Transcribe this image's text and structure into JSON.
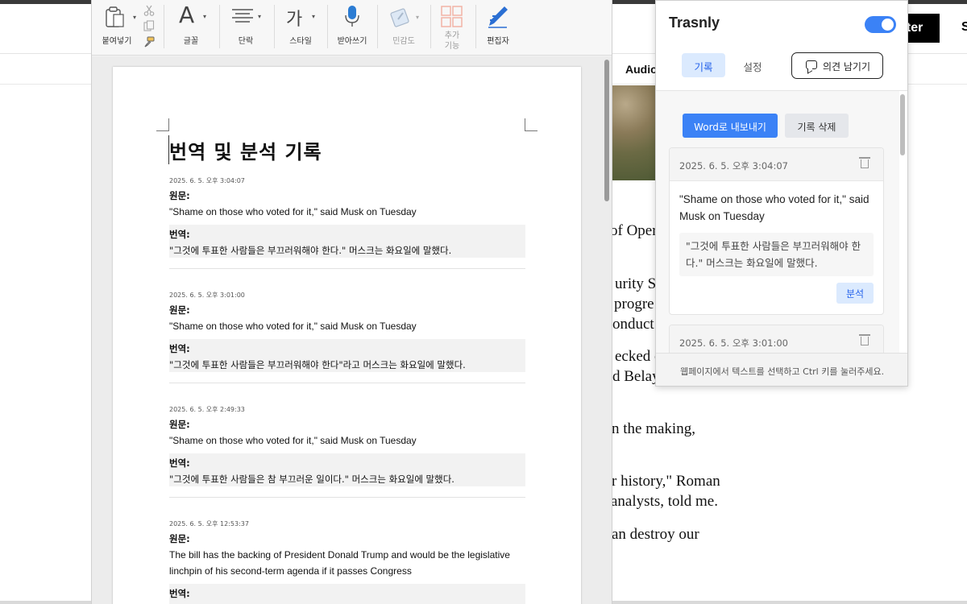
{
  "background_page": {
    "register_label": "ster",
    "cutoff_letter": "S",
    "audio_label": "Audio",
    "text_fragments": [
      "of Oper",
      "urity S",
      "progre",
      "onduct",
      "ecked o",
      "d Belay",
      "n the making,",
      "r history,\" Roman",
      "analysts, told me.",
      "an destroy our"
    ]
  },
  "ribbon": {
    "paste_label": "붙여넣기",
    "font_label": "글꼴",
    "paragraph_label": "단락",
    "style_label": "스타일",
    "dictate_label": "받아쓰기",
    "sensitivity_label": "민감도",
    "addins_label": "추가 기능",
    "editor_label": "편집자",
    "font_glyph": "A",
    "style_glyph": "가"
  },
  "document": {
    "title": "번역 및 분석 기록",
    "entries": [
      {
        "timestamp": "2025. 6. 5. 오후 3:04:07",
        "original_label": "원문:",
        "original": "\"Shame on those who voted for it,\" said Musk on Tuesday",
        "translation_label": "번역:",
        "translation": "\"그것에 투표한 사람들은 부끄러워해야 한다.\" 머스크는 화요일에 말했다."
      },
      {
        "timestamp": "2025. 6. 5. 오후 3:01:00",
        "original_label": "원문:",
        "original": "\"Shame on those who voted for it,\" said Musk on Tuesday",
        "translation_label": "번역:",
        "translation": "\"그것에 투표한 사람들은 부끄러워해야 한다\"라고 머스크는 화요일에 말했다."
      },
      {
        "timestamp": "2025. 6. 5. 오후 2:49:33",
        "original_label": "원문:",
        "original": "\"Shame on those who voted for it,\" said Musk on Tuesday",
        "translation_label": "번역:",
        "translation": "\"그것에 투표한 사람들은 참 부끄러운 일이다.\" 머스크는 화요일에 말했다."
      },
      {
        "timestamp": "2025. 6. 5. 오후 12:53:37",
        "original_label": "원문:",
        "original": "The bill has the backing of President Donald Trump and would be the legislative linchpin of his second-term agenda if it passes Congress",
        "translation_label": "번역:",
        "translation": ""
      }
    ]
  },
  "popup": {
    "brand": "Trasnly",
    "toggle_on": true,
    "tabs": [
      {
        "label": "기록",
        "active": true
      },
      {
        "label": "설정",
        "active": false
      }
    ],
    "feedback_label": "의견 남기기",
    "export_label": "Word로 내보내기",
    "clear_label": "기록 삭제",
    "cards": [
      {
        "timestamp": "2025. 6. 5. 오후 3:04:07",
        "original": "\"Shame on those who voted for it,\" said Musk on Tuesday",
        "translation": "\"그것에 투표한 사람들은 부끄러워해야 한다.\" 머스크는 화요일에 말했다.",
        "analyze_label": "분석"
      },
      {
        "timestamp": "2025. 6. 5. 오후 3:01:00"
      }
    ],
    "footer_hint": "웹페이지에서 텍스트를 선택하고 Ctrl 키를 눌러주세요."
  },
  "colors": {
    "accent": "#3b82f6",
    "accent_light": "#dbeafe",
    "register_bg": "#000000"
  }
}
